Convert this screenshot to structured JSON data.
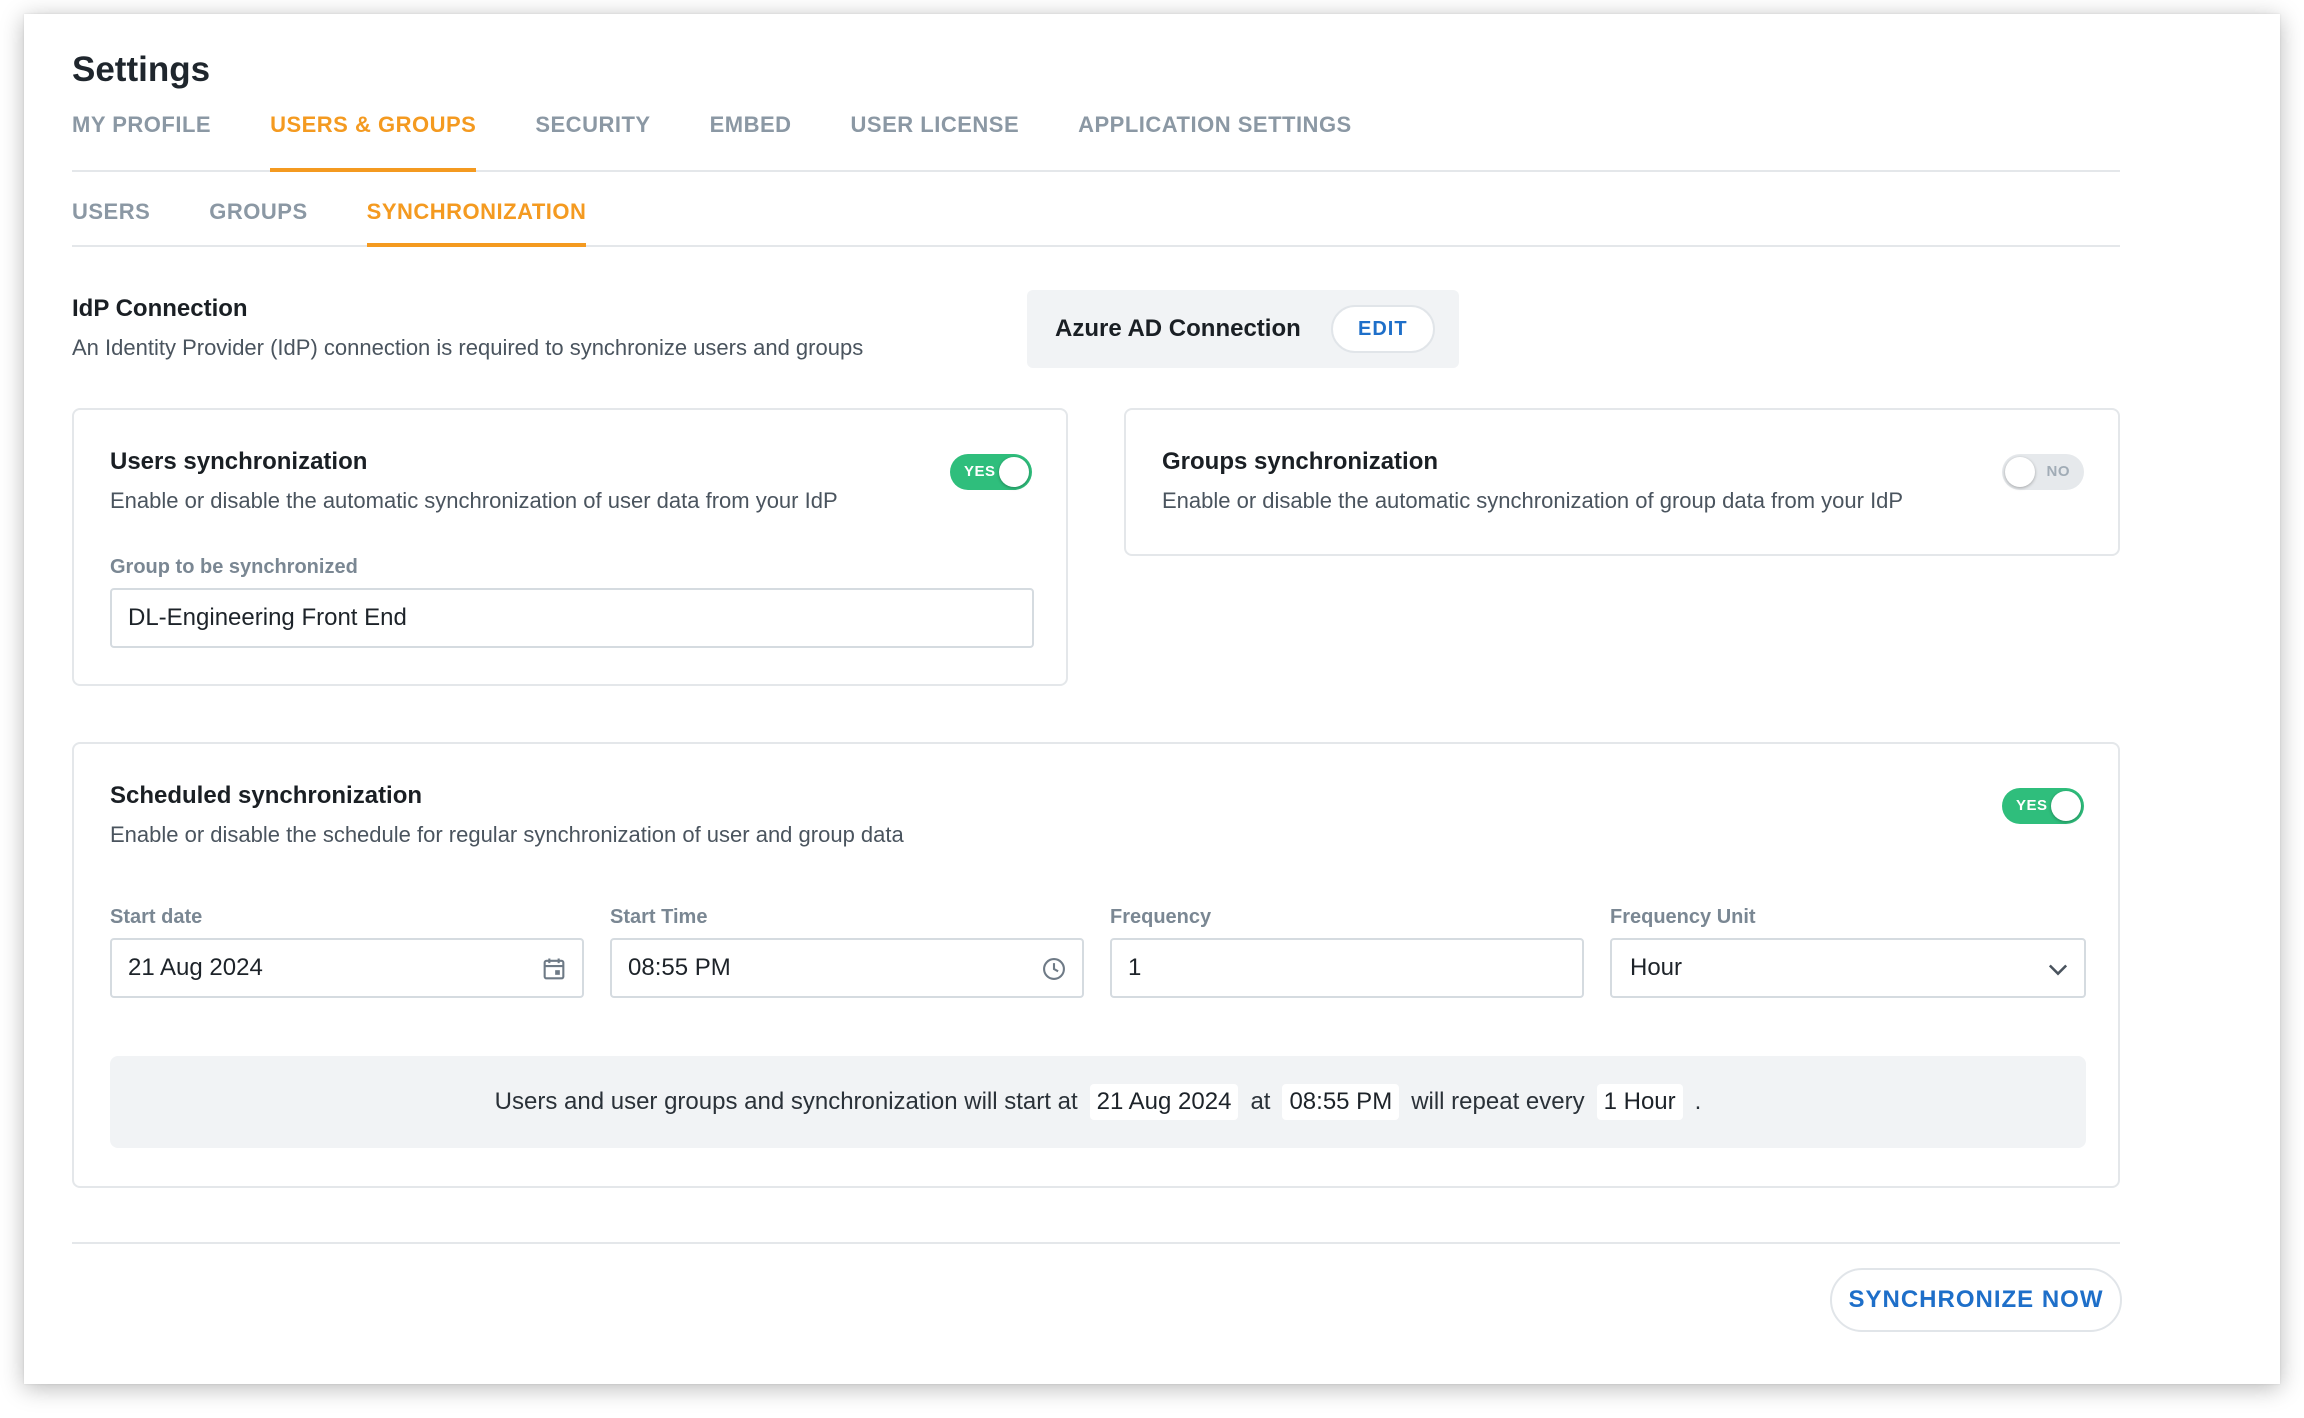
{
  "page": {
    "title": "Settings"
  },
  "main_tabs": [
    {
      "label": "MY PROFILE",
      "active": false
    },
    {
      "label": "USERS & GROUPS",
      "active": true
    },
    {
      "label": "SECURITY",
      "active": false
    },
    {
      "label": "EMBED",
      "active": false
    },
    {
      "label": "USER LICENSE",
      "active": false
    },
    {
      "label": "APPLICATION SETTINGS",
      "active": false
    }
  ],
  "sub_tabs": [
    {
      "label": "USERS",
      "active": false
    },
    {
      "label": "GROUPS",
      "active": false
    },
    {
      "label": "SYNCHRONIZATION",
      "active": true
    }
  ],
  "idp": {
    "title": "IdP Connection",
    "description": "An Identity Provider (IdP) connection is required to synchronize users and groups",
    "connection_label": "Azure AD Connection",
    "edit_label": "EDIT"
  },
  "users_sync": {
    "title": "Users synchronization",
    "description": "Enable or disable the automatic synchronization of user data from your IdP",
    "toggle_label": "YES",
    "enabled": true,
    "group_label": "Group to be synchronized",
    "group_value": "DL-Engineering Front End"
  },
  "groups_sync": {
    "title": "Groups synchronization",
    "description": "Enable or disable the automatic synchronization of group data from your IdP",
    "toggle_label": "NO",
    "enabled": false
  },
  "scheduled_sync": {
    "title": "Scheduled synchronization",
    "description": "Enable or disable the schedule for regular synchronization of user and group data",
    "toggle_label": "YES",
    "enabled": true,
    "start_date_label": "Start date",
    "start_date_value": "21 Aug 2024",
    "start_time_label": "Start Time",
    "start_time_value": "08:55 PM",
    "frequency_label": "Frequency",
    "frequency_value": "1",
    "frequency_unit_label": "Frequency Unit",
    "frequency_unit_value": "Hour",
    "summary": {
      "prefix": "Users and user groups and synchronization will start at",
      "date": "21 Aug 2024",
      "at": "at",
      "time": "08:55 PM",
      "repeat": "will repeat every",
      "interval": "1 Hour",
      "suffix": "."
    }
  },
  "actions": {
    "sync_now_label": "SYNCHRONIZE NOW"
  },
  "colors": {
    "accent": "#f49a20",
    "link": "#1e6fc9",
    "toggle_on": "#2fbe7c",
    "toggle_off": "#e6e9ec"
  }
}
